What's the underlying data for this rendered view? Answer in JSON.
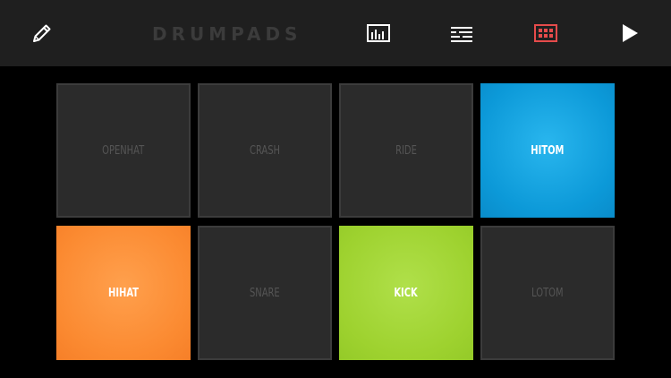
{
  "header": {
    "title": "DRUMPADS",
    "icons": {
      "edit": "pencil-icon",
      "mixer": "mixer-icon",
      "sequencer": "sequencer-icon",
      "pads": "pads-grid-icon",
      "play": "play-icon"
    },
    "active_icon_color": "#e54b4b",
    "icon_color": "#ffffff"
  },
  "pads": [
    {
      "label": "OPENHAT",
      "active": false,
      "color": "#2b2b2b"
    },
    {
      "label": "CRASH",
      "active": false,
      "color": "#2b2b2b"
    },
    {
      "label": "RIDE",
      "active": false,
      "color": "#2b2b2b"
    },
    {
      "label": "HITOM",
      "active": true,
      "color": "#1aa6e2"
    },
    {
      "label": "HIHAT",
      "active": true,
      "color": "#fb8a31"
    },
    {
      "label": "SNARE",
      "active": false,
      "color": "#2b2b2b"
    },
    {
      "label": "KICK",
      "active": true,
      "color": "#9ed22f"
    },
    {
      "label": "LOTOM",
      "active": false,
      "color": "#2b2b2b"
    }
  ]
}
